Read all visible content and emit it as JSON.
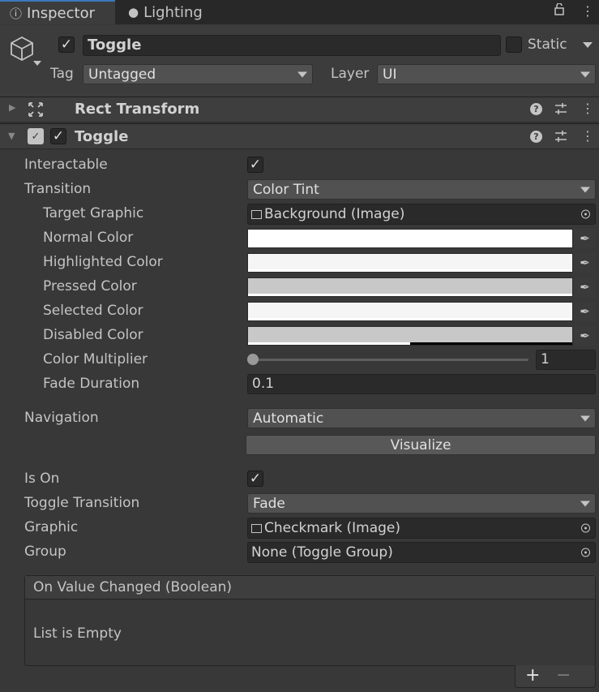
{
  "tabs": [
    {
      "label": "Inspector",
      "icon": "info-icon"
    },
    {
      "label": "Lighting",
      "icon": "lightbulb-icon"
    }
  ],
  "header": {
    "object_name": "Toggle",
    "active": true,
    "static_label": "Static",
    "static_checked": false,
    "tag_label": "Tag",
    "tag_value": "Untagged",
    "layer_label": "Layer",
    "layer_value": "UI"
  },
  "components": {
    "rect_transform": {
      "title": "Rect Transform",
      "expanded": false
    },
    "toggle": {
      "title": "Toggle",
      "enabled": true,
      "expanded": true
    }
  },
  "fields": {
    "interactable": {
      "label": "Interactable",
      "checked": true
    },
    "transition": {
      "label": "Transition",
      "value": "Color Tint"
    },
    "target_graphic": {
      "label": "Target Graphic",
      "value": "Background (Image)"
    },
    "normal_color": {
      "label": "Normal Color",
      "color": "#ffffff",
      "alpha": 1.0
    },
    "highlighted_color": {
      "label": "Highlighted Color",
      "color": "#f5f5f5",
      "alpha": 1.0
    },
    "pressed_color": {
      "label": "Pressed Color",
      "color": "#c8c8c8",
      "alpha": 1.0
    },
    "selected_color": {
      "label": "Selected Color",
      "color": "#f5f5f5",
      "alpha": 1.0
    },
    "disabled_color": {
      "label": "Disabled Color",
      "color": "#c8c8c8",
      "alpha": 0.5
    },
    "color_multiplier": {
      "label": "Color Multiplier",
      "value": "1",
      "slider_fraction": 0.0
    },
    "fade_duration": {
      "label": "Fade Duration",
      "value": "0.1"
    },
    "navigation": {
      "label": "Navigation",
      "value": "Automatic"
    },
    "visualize_button": "Visualize",
    "is_on": {
      "label": "Is On",
      "checked": true
    },
    "toggle_transition": {
      "label": "Toggle Transition",
      "value": "Fade"
    },
    "graphic": {
      "label": "Graphic",
      "value": "Checkmark (Image)"
    },
    "group": {
      "label": "Group",
      "value": "None (Toggle Group)"
    }
  },
  "event": {
    "title": "On Value Changed (Boolean)",
    "empty_text": "List is Empty",
    "add_label": "+",
    "remove_label": "−"
  },
  "colors": {
    "accent": "#3a79bb",
    "background": "#383838"
  }
}
